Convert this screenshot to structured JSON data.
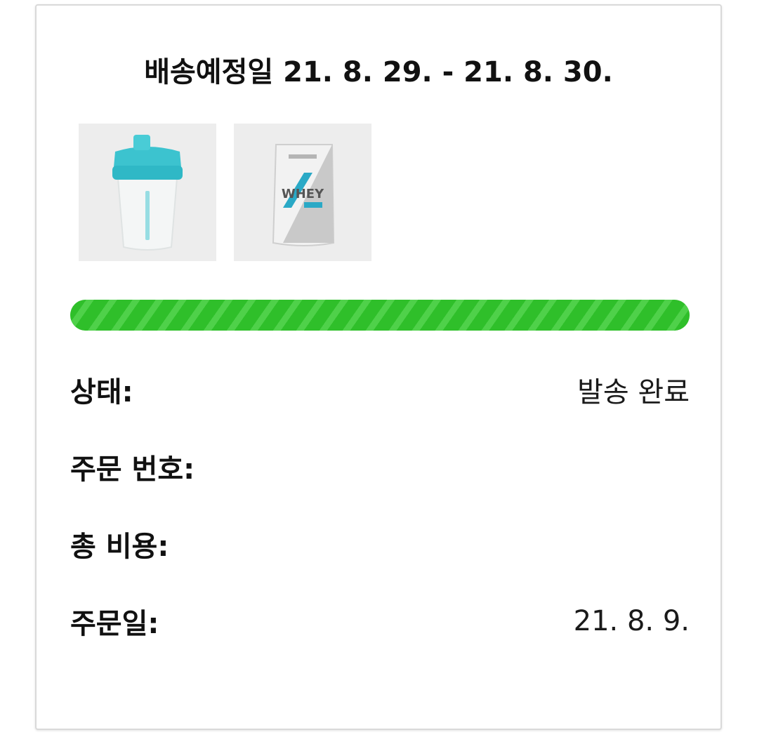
{
  "shipment": {
    "title": "배송예정일 21. 8. 29. - 21. 8. 30.",
    "products": [
      {
        "name": "shaker-bottle",
        "accent_color": "#3cc3cf"
      },
      {
        "name": "whey-protein-pouch",
        "accent_color": "#2aa9c6",
        "package_text": "WHEY"
      }
    ],
    "progress": {
      "value": 1.0,
      "color": "#2fbf2a"
    },
    "details": {
      "status_label": "상태:",
      "status_value": "발송 완료",
      "order_number_label": "주문 번호:",
      "order_number_value": "",
      "total_label": "총 비용:",
      "total_value": "",
      "order_date_label": "주문일:",
      "order_date_value": "21. 8. 9."
    }
  }
}
